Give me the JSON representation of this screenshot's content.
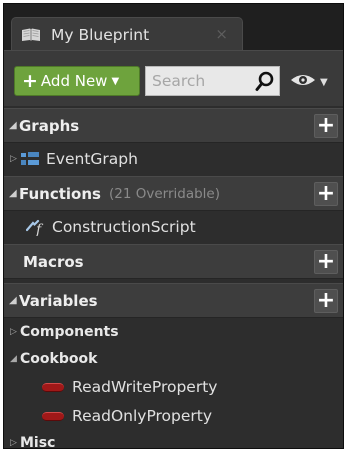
{
  "tab": {
    "title": "My Blueprint",
    "icon": "book-icon",
    "close_label": "×"
  },
  "toolbar": {
    "add_new_label": "Add New",
    "search_placeholder": "Search",
    "accent_color": "#6ea33d"
  },
  "sections": {
    "graphs": {
      "title": "Graphs",
      "items": [
        {
          "label": "EventGraph",
          "icon": "event-graph-icon"
        }
      ]
    },
    "functions": {
      "title": "Functions",
      "subtitle": "(21 Overridable)",
      "items": [
        {
          "label": "ConstructionScript",
          "icon": "function-icon"
        }
      ]
    },
    "macros": {
      "title": "Macros"
    },
    "variables": {
      "title": "Variables",
      "groups": [
        {
          "label": "Components",
          "expanded": false
        },
        {
          "label": "Cookbook",
          "expanded": true,
          "items": [
            {
              "label": "ReadWriteProperty",
              "color": "#a01818"
            },
            {
              "label": "ReadOnlyProperty",
              "color": "#a01818"
            }
          ]
        },
        {
          "label": "Misc",
          "expanded": false
        }
      ]
    }
  }
}
